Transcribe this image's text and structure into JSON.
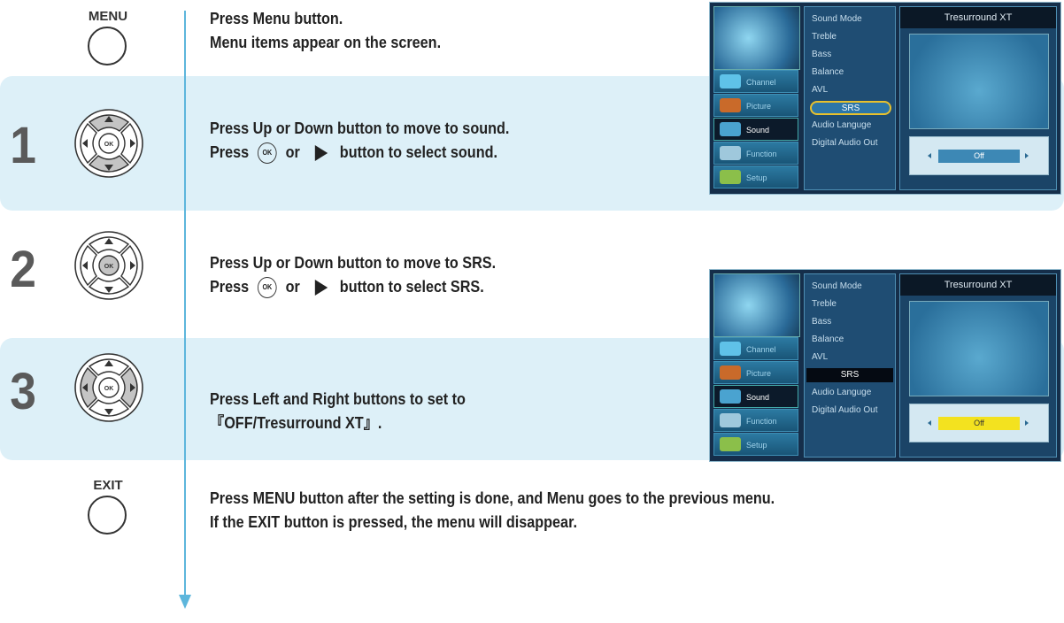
{
  "steps": {
    "menu_label": "MENU",
    "exit_label": "EXIT",
    "step1_num": "1",
    "step2_num": "2",
    "step3_num": "3"
  },
  "instructions": {
    "menu_line1": "Press Menu button.",
    "menu_line2": "Menu items appear on the screen.",
    "s1_line1": "Press Up or Down button to move to sound.",
    "s1_press": "Press",
    "s1_or": "or",
    "s1_tail": "button to select sound.",
    "s2_line1": "Press Up or Down button to move to SRS.",
    "s2_press": "Press",
    "s2_or": "or",
    "s2_tail": "button to select SRS.",
    "s3_line1": "Press Left and Right buttons to set to",
    "s3_line2": "『OFF/Tresurround XT』.",
    "exit_line1": "Press MENU button after the setting is done, and Menu goes to the previous menu.",
    "exit_line2": "If the EXIT button is pressed, the menu will disappear.",
    "ok_glyph": "OK"
  },
  "tv_menu": {
    "categories": [
      "Channel",
      "Picture",
      "Sound",
      "Function",
      "Setup"
    ],
    "items": [
      "Sound Mode",
      "Treble",
      "Bass",
      "Balance",
      "AVL",
      "SRS",
      "Audio Languge",
      "Digital Audio Out"
    ],
    "panel_title": "Tresurround XT",
    "value": "Off"
  },
  "colors": {
    "band": "#ddf0f8",
    "timeline": "#5db6dc",
    "highlight_yellow": "#f3e21f"
  }
}
